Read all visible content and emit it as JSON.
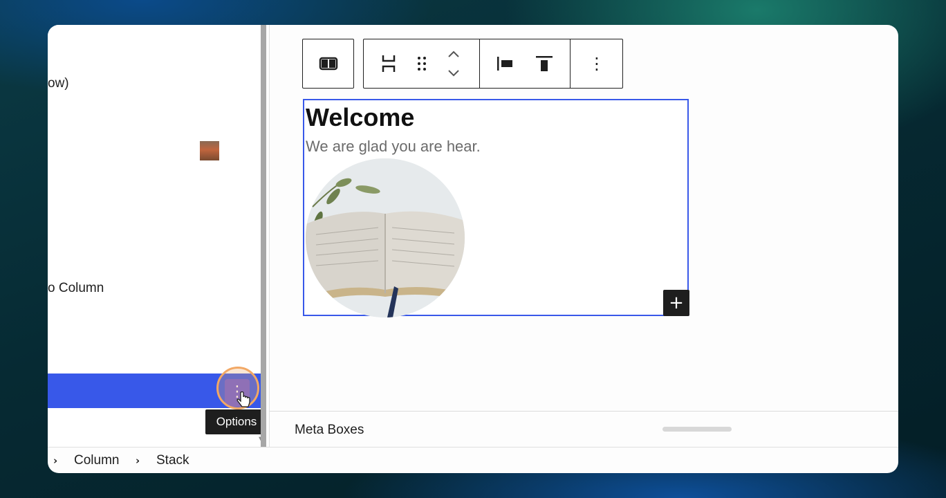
{
  "left_panel": {
    "item_partial_1": "ow)",
    "item_partial_2": "o Column",
    "options_button_glyph": "⋮",
    "tooltip": "Options"
  },
  "toolbar": {
    "more_glyph": "⋮"
  },
  "block": {
    "title": "Welcome",
    "subtitle": "We are glad you are hear.",
    "add_glyph": "+"
  },
  "meta_boxes": {
    "label": "Meta Boxes"
  },
  "breadcrumb": {
    "items": [
      "Column",
      "Stack"
    ]
  },
  "colors": {
    "selection": "#3858e9",
    "tooltip_bg": "#1e1e1e"
  }
}
